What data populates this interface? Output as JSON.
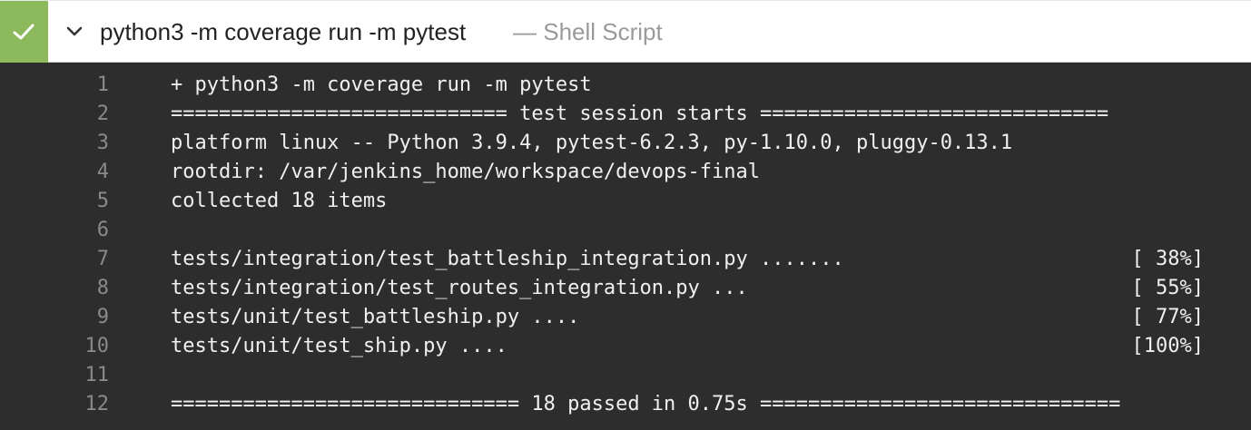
{
  "step": {
    "status": "success",
    "status_color": "#8cb95c",
    "title": "python3 -m coverage run -m pytest",
    "subtitle": "— Shell Script",
    "icons": {
      "status": "check-icon",
      "expand": "chevron-down-icon"
    }
  },
  "log": {
    "lines": [
      {
        "n": "1",
        "text": "+ python3 -m coverage run -m pytest",
        "pct": ""
      },
      {
        "n": "2",
        "text": "============================ test session starts =============================",
        "pct": ""
      },
      {
        "n": "3",
        "text": "platform linux -- Python 3.9.4, pytest-6.2.3, py-1.10.0, pluggy-0.13.1",
        "pct": ""
      },
      {
        "n": "4",
        "text": "rootdir: /var/jenkins_home/workspace/devops-final",
        "pct": ""
      },
      {
        "n": "5",
        "text": "collected 18 items",
        "pct": ""
      },
      {
        "n": "6",
        "text": "",
        "pct": ""
      },
      {
        "n": "7",
        "text": "tests/integration/test_battleship_integration.py .......",
        "pct": "[ 38%]"
      },
      {
        "n": "8",
        "text": "tests/integration/test_routes_integration.py ...",
        "pct": "[ 55%]"
      },
      {
        "n": "9",
        "text": "tests/unit/test_battleship.py ....",
        "pct": "[ 77%]"
      },
      {
        "n": "10",
        "text": "tests/unit/test_ship.py ....",
        "pct": "[100%]"
      },
      {
        "n": "11",
        "text": "",
        "pct": ""
      },
      {
        "n": "12",
        "text": "============================= 18 passed in 0.75s ==============================",
        "pct": ""
      }
    ]
  }
}
